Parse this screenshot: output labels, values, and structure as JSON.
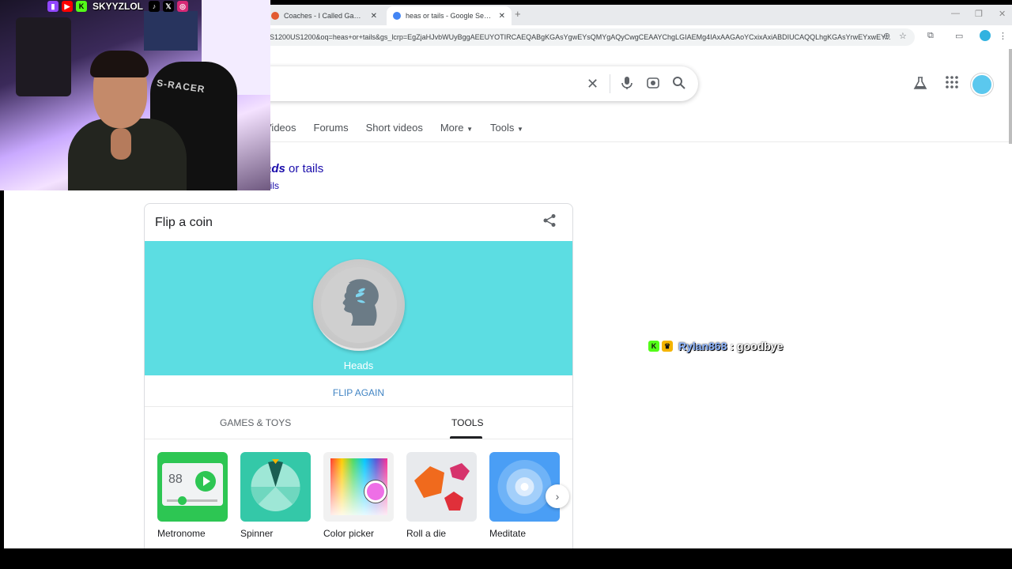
{
  "browser": {
    "tabs": [
      {
        "label": "Coaches - I Called Game by Ho",
        "favicon_color": "#e25b2f"
      },
      {
        "label": "heas or tails - Google Search",
        "favicon_color": "#4285f4"
      }
    ],
    "new_tab": "+",
    "url": "S1200US1200&oq=heas+or+tails&gs_lcrp=EgZjaHJvbWUyBggAEEUYOTIRCAEQABgKGAsYgwEYsQMYgAQyCwgCEAAYChgLGIAEMg4IAxAAGAoYCxixAxiABDIUCAQQLhgKGAsYrwEYxwEY..."
  },
  "search": {
    "clear_icon": "close-icon",
    "voice_icon": "mic-icon",
    "lens_icon": "camera-icon",
    "search_icon": "search-icon"
  },
  "nav": {
    "tabs": [
      "Videos",
      "Forums",
      "Short videos",
      "More",
      "Tools"
    ]
  },
  "spelling": {
    "suggestion_bold": "ads",
    "suggestion_rest": " or tails",
    "search_instead": "ails"
  },
  "coin_card": {
    "title": "Flip a coin",
    "result": "Heads",
    "flip_again": "FLIP AGAIN",
    "accent": "#5cdde2",
    "category_tabs": [
      "GAMES & TOYS",
      "TOOLS"
    ],
    "active_tab": "TOOLS",
    "tools": [
      {
        "label": "Metronome",
        "color": "#2dc653",
        "value": "88"
      },
      {
        "label": "Spinner",
        "color": "#34c8a8"
      },
      {
        "label": "Color picker",
        "color": "#f1f1f1"
      },
      {
        "label": "Roll a die",
        "color": "#e8eaed"
      },
      {
        "label": "Meditate",
        "color": "#4a9ef5"
      }
    ]
  },
  "webcam": {
    "handle": "SKYYZLOL",
    "chair_text": "S-RACER"
  },
  "chat": {
    "user": "Rylan868",
    "separator": ":",
    "message": "goodbye"
  }
}
